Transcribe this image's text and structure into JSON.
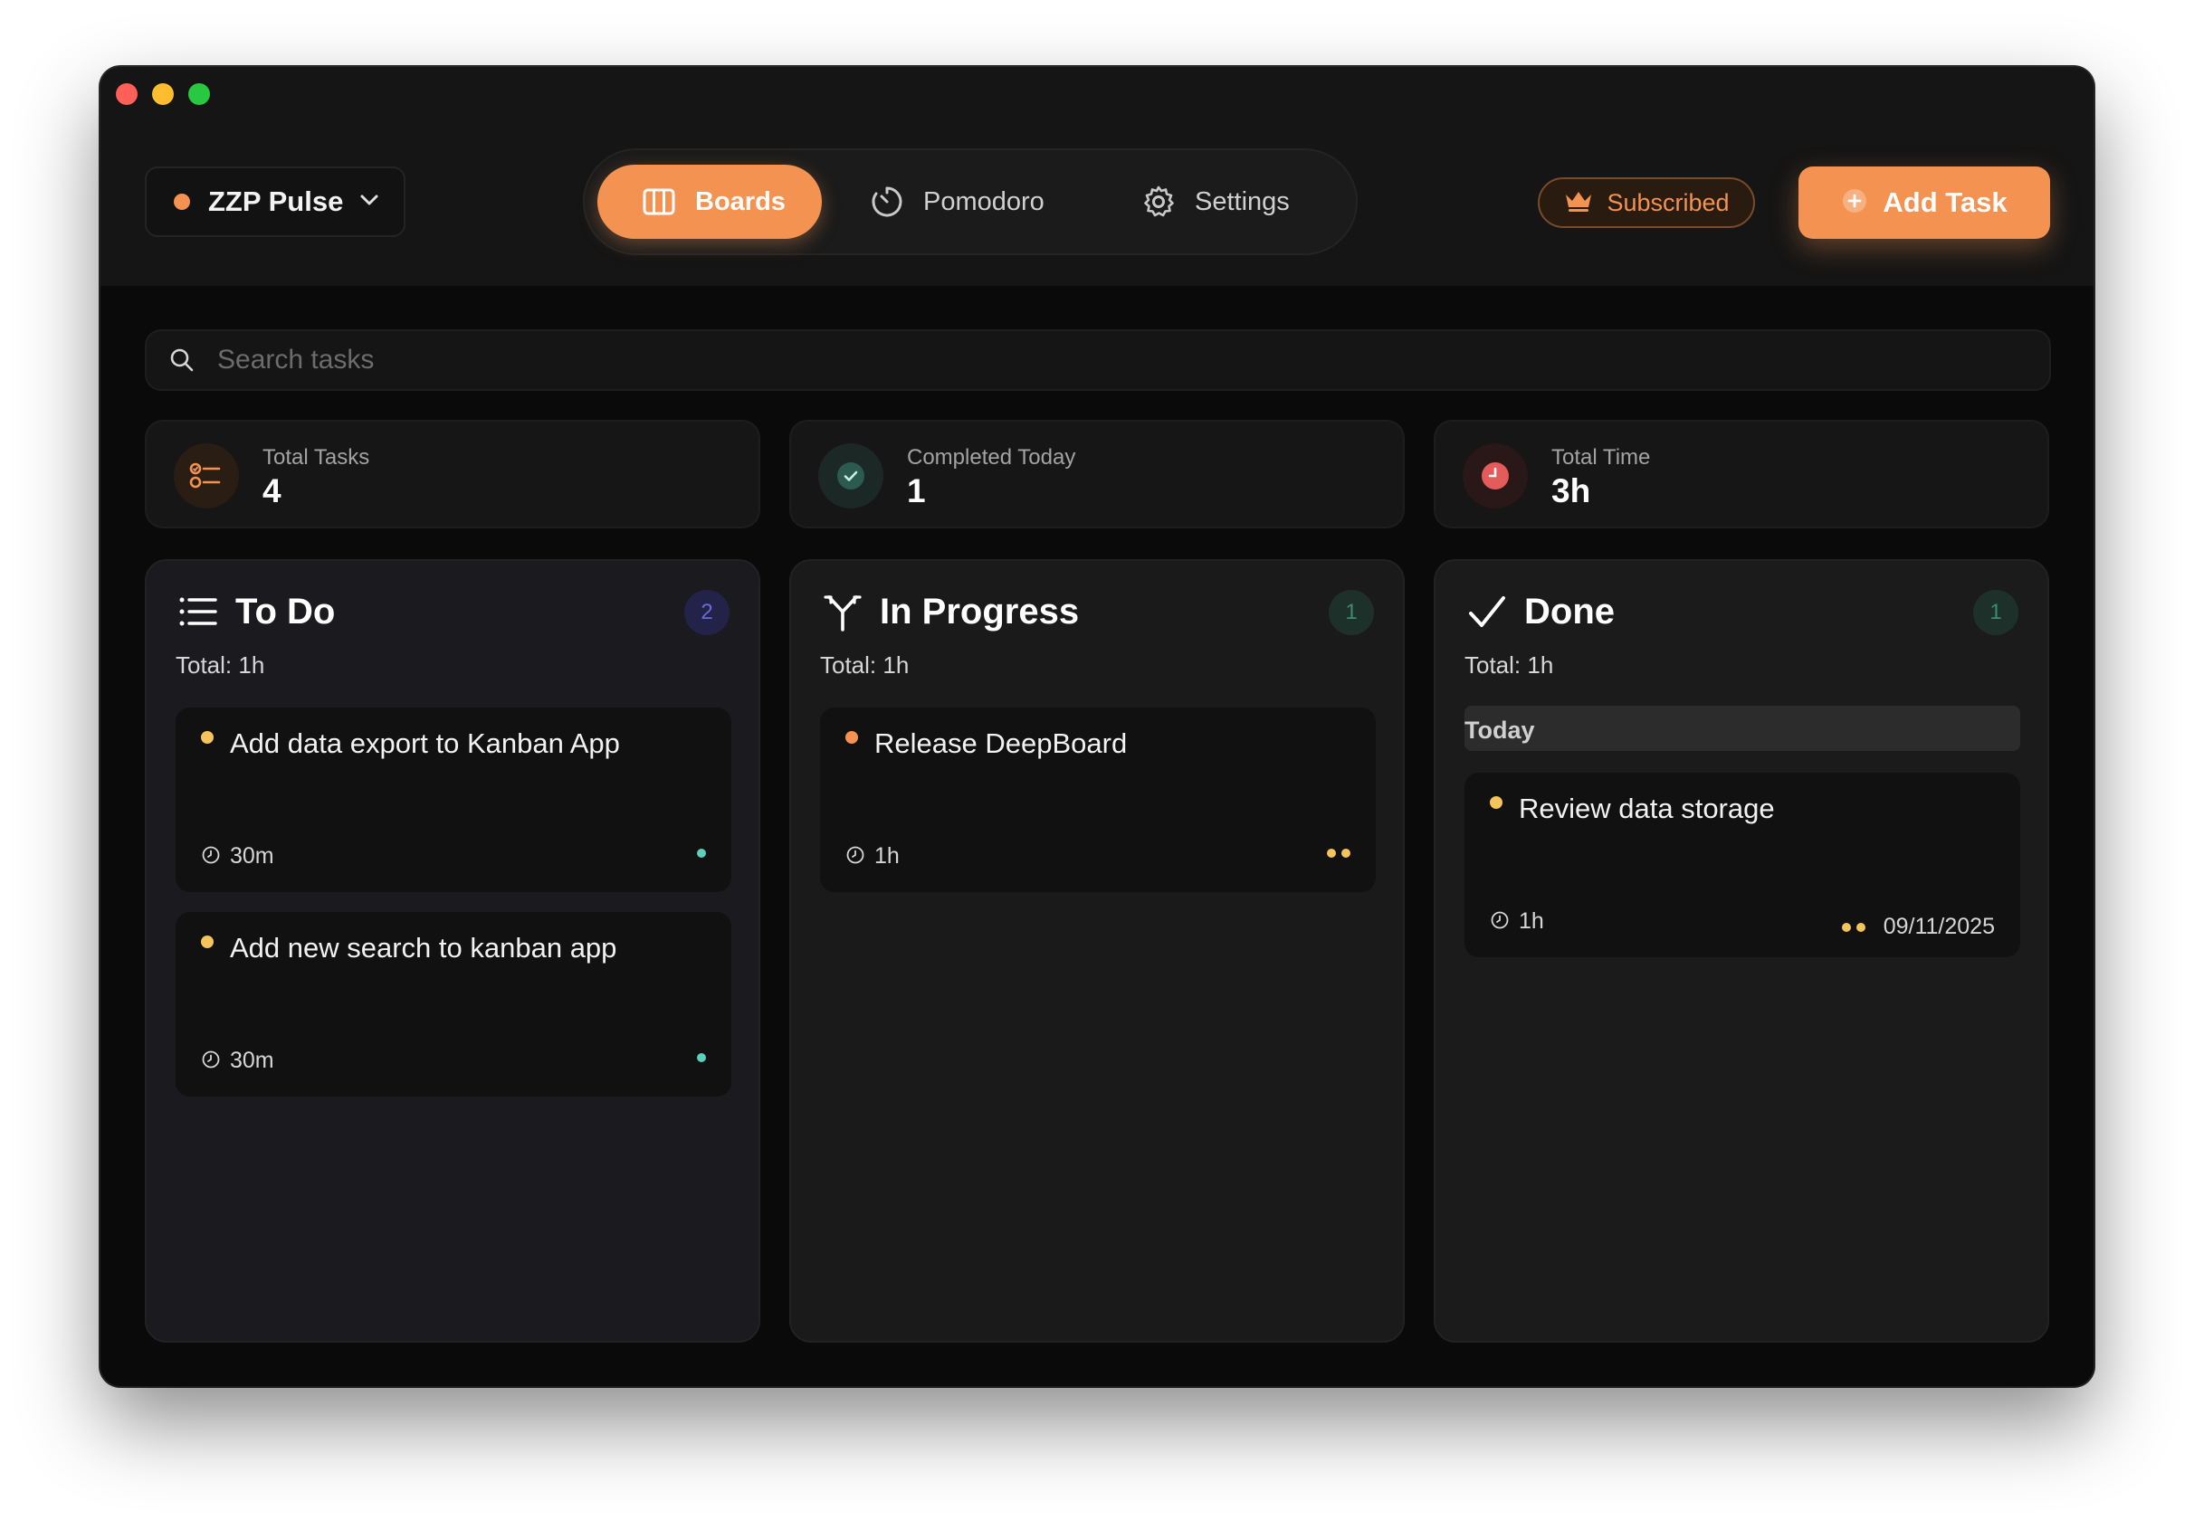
{
  "header": {
    "workspace": {
      "name": "ZZP Pulse",
      "dot_color": "#f39251"
    },
    "tabs": [
      {
        "label": "Boards",
        "icon": "columns-icon",
        "active": true
      },
      {
        "label": "Pomodoro",
        "icon": "timer-icon",
        "active": false
      },
      {
        "label": "Settings",
        "icon": "gear-icon",
        "active": false
      }
    ],
    "subscribed_label": "Subscribed",
    "add_task_label": "Add Task"
  },
  "search": {
    "placeholder": "Search tasks",
    "value": ""
  },
  "stats": [
    {
      "label": "Total Tasks",
      "value": "4",
      "icon": "checklist-icon"
    },
    {
      "label": "Completed Today",
      "value": "1",
      "icon": "check-circle-icon"
    },
    {
      "label": "Total Time",
      "value": "3h",
      "icon": "clock-icon"
    }
  ],
  "columns": [
    {
      "title": "To Do",
      "icon": "list-icon",
      "count": "2",
      "total": "Total: 1h",
      "cards": [
        {
          "title": "Add data export to Kanban App",
          "time": "30m",
          "priority_color": "#f5c45a",
          "status_dots": 1,
          "status_color": "#5fd0b8"
        },
        {
          "title": "Add new search to kanban app",
          "time": "30m",
          "priority_color": "#f5c45a",
          "status_dots": 1,
          "status_color": "#5fd0b8"
        }
      ]
    },
    {
      "title": "In Progress",
      "icon": "branch-icon",
      "count": "1",
      "total": "Total: 1h",
      "cards": [
        {
          "title": "Release DeepBoard",
          "time": "1h",
          "priority_color": "#f39251",
          "status_dots": 2,
          "status_color": "#f5c45a"
        }
      ]
    },
    {
      "title": "Done",
      "icon": "checkmark-icon",
      "count": "1",
      "total": "Total: 1h",
      "group": "Today",
      "cards": [
        {
          "title": "Review data storage",
          "time": "1h",
          "priority_color": "#f5c45a",
          "status_dots": 2,
          "status_color": "#f5c45a",
          "date": "09/11/2025"
        }
      ]
    }
  ],
  "colors": {
    "accent": "#f39251",
    "window_bg": "#0a0a0a",
    "card_bg": "#111111",
    "todo_count_bg": "#23234a",
    "todo_count_fg": "#6a6ad8",
    "green_count_bg": "#1e302a",
    "green_count_fg": "#3e8b74"
  }
}
